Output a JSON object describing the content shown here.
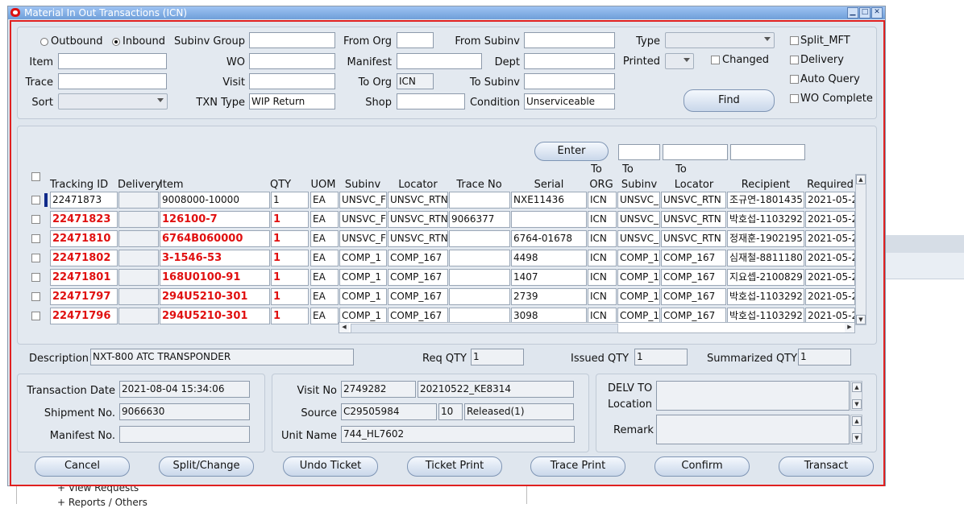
{
  "window": {
    "title": "Material In Out Transactions (ICN)"
  },
  "background": {
    "tree_items": [
      "+ View Requests",
      "+ Reports / Others"
    ]
  },
  "query": {
    "outbound_label": "Outbound",
    "inbound_label": "Inbound",
    "direction_selected": "Inbound",
    "labels": {
      "item": "Item",
      "trace": "Trace",
      "sort": "Sort",
      "subinv_group": "Subinv Group",
      "wo": "WO",
      "visit": "Visit",
      "txn_type": "TXN Type",
      "from_org": "From Org",
      "manifest": "Manifest",
      "to_org": "To Org",
      "shop": "Shop",
      "from_subinv": "From Subinv",
      "dept": "Dept",
      "to_subinv": "To Subinv",
      "condition": "Condition",
      "type": "Type",
      "printed": "Printed",
      "changed": "Changed",
      "split_mft": "Split_MFT",
      "delivery": "Delivery",
      "auto_query": "Auto Query",
      "wo_complete": "WO Complete"
    },
    "values": {
      "item": "",
      "trace": "",
      "sort": "",
      "subinv_group": "",
      "wo": "",
      "visit": "",
      "txn_type": "WIP Return",
      "from_org": "",
      "manifest": "",
      "to_org": "ICN",
      "shop": "",
      "from_subinv": "",
      "dept": "",
      "to_subinv": "",
      "condition": "Unserviceable",
      "type": "",
      "printed": ""
    },
    "find_button": "Find"
  },
  "grid": {
    "enter_button": "Enter",
    "headers": {
      "tracking_id": "Tracking ID",
      "delivery": "Delivery",
      "item": "Item",
      "qty": "QTY",
      "uom": "UOM",
      "subinv": "Subinv",
      "locator": "Locator",
      "trace_no": "Trace No",
      "serial": "Serial",
      "to_org_1": "To",
      "to_org_2": "ORG",
      "to_subinv_1": "To",
      "to_subinv_2": "Subinv",
      "to_locator_1": "To",
      "to_locator_2": "Locator",
      "recipient": "Recipient",
      "required": "Required"
    },
    "rows": [
      {
        "tracking_id": "22471873",
        "delivery": "",
        "item": "9008000-10000",
        "qty": "1",
        "uom": "EA",
        "subinv": "UNSVC_F",
        "locator": "UNSVC_RTN",
        "trace_no": "",
        "serial": "NXE11436",
        "to_org": "ICN",
        "to_subinv": "UNSVC_",
        "to_locator": "UNSVC_RTN",
        "recipient": "조규연-1801435",
        "required": "2021-05-2",
        "highlight": false
      },
      {
        "tracking_id": "22471823",
        "delivery": "",
        "item": "126100-7",
        "qty": "1",
        "uom": "EA",
        "subinv": "UNSVC_F",
        "locator": "UNSVC_RTN",
        "trace_no": "9066377",
        "serial": "",
        "to_org": "ICN",
        "to_subinv": "UNSVC_",
        "to_locator": "UNSVC_RTN",
        "recipient": "박호섭-1103292",
        "required": "2021-05-2",
        "highlight": true
      },
      {
        "tracking_id": "22471810",
        "delivery": "",
        "item": "6764B060000",
        "qty": "1",
        "uom": "EA",
        "subinv": "UNSVC_F",
        "locator": "UNSVC_RTN",
        "trace_no": "",
        "serial": "6764-01678",
        "to_org": "ICN",
        "to_subinv": "UNSVC_",
        "to_locator": "UNSVC_RTN",
        "recipient": "정재훈-1902195",
        "required": "2021-05-2",
        "highlight": true
      },
      {
        "tracking_id": "22471802",
        "delivery": "",
        "item": "3-1546-53",
        "qty": "1",
        "uom": "EA",
        "subinv": "COMP_1",
        "locator": "COMP_167",
        "trace_no": "",
        "serial": "4498",
        "to_org": "ICN",
        "to_subinv": "COMP_1",
        "to_locator": "COMP_167",
        "recipient": "심재철-8811180",
        "required": "2021-05-2",
        "highlight": true
      },
      {
        "tracking_id": "22471801",
        "delivery": "",
        "item": "168U0100-91",
        "qty": "1",
        "uom": "EA",
        "subinv": "COMP_1",
        "locator": "COMP_167",
        "trace_no": "",
        "serial": "1407",
        "to_org": "ICN",
        "to_subinv": "COMP_1",
        "to_locator": "COMP_167",
        "recipient": "지요셉-2100829",
        "required": "2021-05-2",
        "highlight": true
      },
      {
        "tracking_id": "22471797",
        "delivery": "",
        "item": "294U5210-301",
        "qty": "1",
        "uom": "EA",
        "subinv": "COMP_1",
        "locator": "COMP_167",
        "trace_no": "",
        "serial": "2739",
        "to_org": "ICN",
        "to_subinv": "COMP_1",
        "to_locator": "COMP_167",
        "recipient": "박호섭-1103292",
        "required": "2021-05-2",
        "highlight": true
      },
      {
        "tracking_id": "22471796",
        "delivery": "",
        "item": "294U5210-301",
        "qty": "1",
        "uom": "EA",
        "subinv": "COMP_1",
        "locator": "COMP_167",
        "trace_no": "",
        "serial": "3098",
        "to_org": "ICN",
        "to_subinv": "COMP_1",
        "to_locator": "COMP_167",
        "recipient": "박호섭-1103292",
        "required": "2021-05-2",
        "highlight": true
      }
    ]
  },
  "summary": {
    "description_label": "Description",
    "description": "NXT-800 ATC TRANSPONDER",
    "req_qty_label": "Req QTY",
    "req_qty": "1",
    "issued_qty_label": "Issued QTY",
    "issued_qty": "1",
    "summarized_qty_label": "Summarized QTY",
    "summarized_qty": "1"
  },
  "details": {
    "transaction_date_label": "Transaction Date",
    "transaction_date": "2021-08-04 15:34:06",
    "shipment_no_label": "Shipment No.",
    "shipment_no": "9066630",
    "manifest_no_label": "Manifest No.",
    "manifest_no": "",
    "visit_no_label": "Visit No",
    "visit_no": "2749282",
    "visit_ref": "20210522_KE8314",
    "source_label": "Source",
    "source": "C29505984",
    "source_line": "10",
    "source_status": "Released(1)",
    "unit_name_label": "Unit Name",
    "unit_name": "744_HL7602",
    "delv_to_label_1": "DELV TO",
    "delv_to_label_2": "Location",
    "delv_to": "",
    "remark_label": "Remark",
    "remark": ""
  },
  "actions": {
    "cancel": "Cancel",
    "split_change": "Split/Change",
    "undo_ticket": "Undo Ticket",
    "ticket_print": "Ticket Print",
    "trace_print": "Trace Print",
    "confirm": "Confirm",
    "transact": "Transact"
  }
}
